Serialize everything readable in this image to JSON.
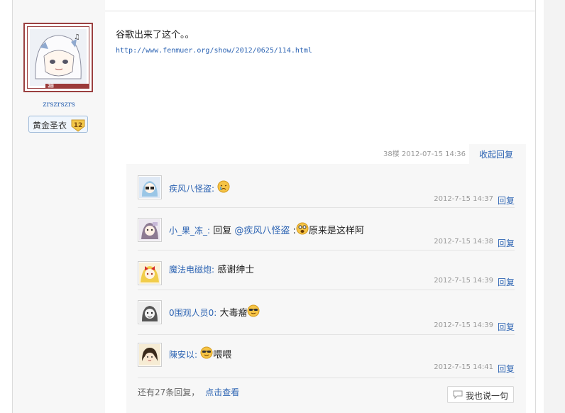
{
  "author": {
    "username": "zrszrszrs",
    "avatar_badge": "神",
    "rank_title": "黄金圣衣",
    "rank_level": "12"
  },
  "post": {
    "text": "谷歌出来了这个。。",
    "link": "http://www.fenmuer.org/show/2012/0625/114.html",
    "meta": "38楼 2012-07-15 14:36",
    "collapse_label": "收起回复"
  },
  "replies": [
    {
      "user": "疾风八怪盗",
      "separator": ":",
      "text": "",
      "time": "2012-7-15 14:37",
      "reply_label": "回复"
    },
    {
      "user": "小_果_冻_",
      "separator": ":",
      "prefix": "回复",
      "mention": "@疾风八怪盗",
      "mention_suffix": " :",
      "text": "原来是这样阿",
      "time": "2012-7-15 14:38",
      "reply_label": "回复"
    },
    {
      "user": "魔法电磁炮",
      "separator": ":",
      "text": "感谢绅士",
      "time": "2012-7-15 14:39",
      "reply_label": "回复"
    },
    {
      "user": "0围观人员0",
      "separator": ":",
      "text": "大毒瘤",
      "time": "2012-7-15 14:39",
      "reply_label": "回复"
    },
    {
      "user": "陳安以",
      "separator": ":",
      "text": "喂喂",
      "time": "2012-7-15 14:41",
      "reply_label": "回复"
    }
  ],
  "footer": {
    "more_text": "还有27条回复，",
    "more_link": "点击查看",
    "say_button": "我也说一句"
  },
  "colors": {
    "link": "#2d64b3",
    "avatar_frame": "#9b4040",
    "reply_bg": "#f7f7f7",
    "meta_gray": "#999999"
  }
}
